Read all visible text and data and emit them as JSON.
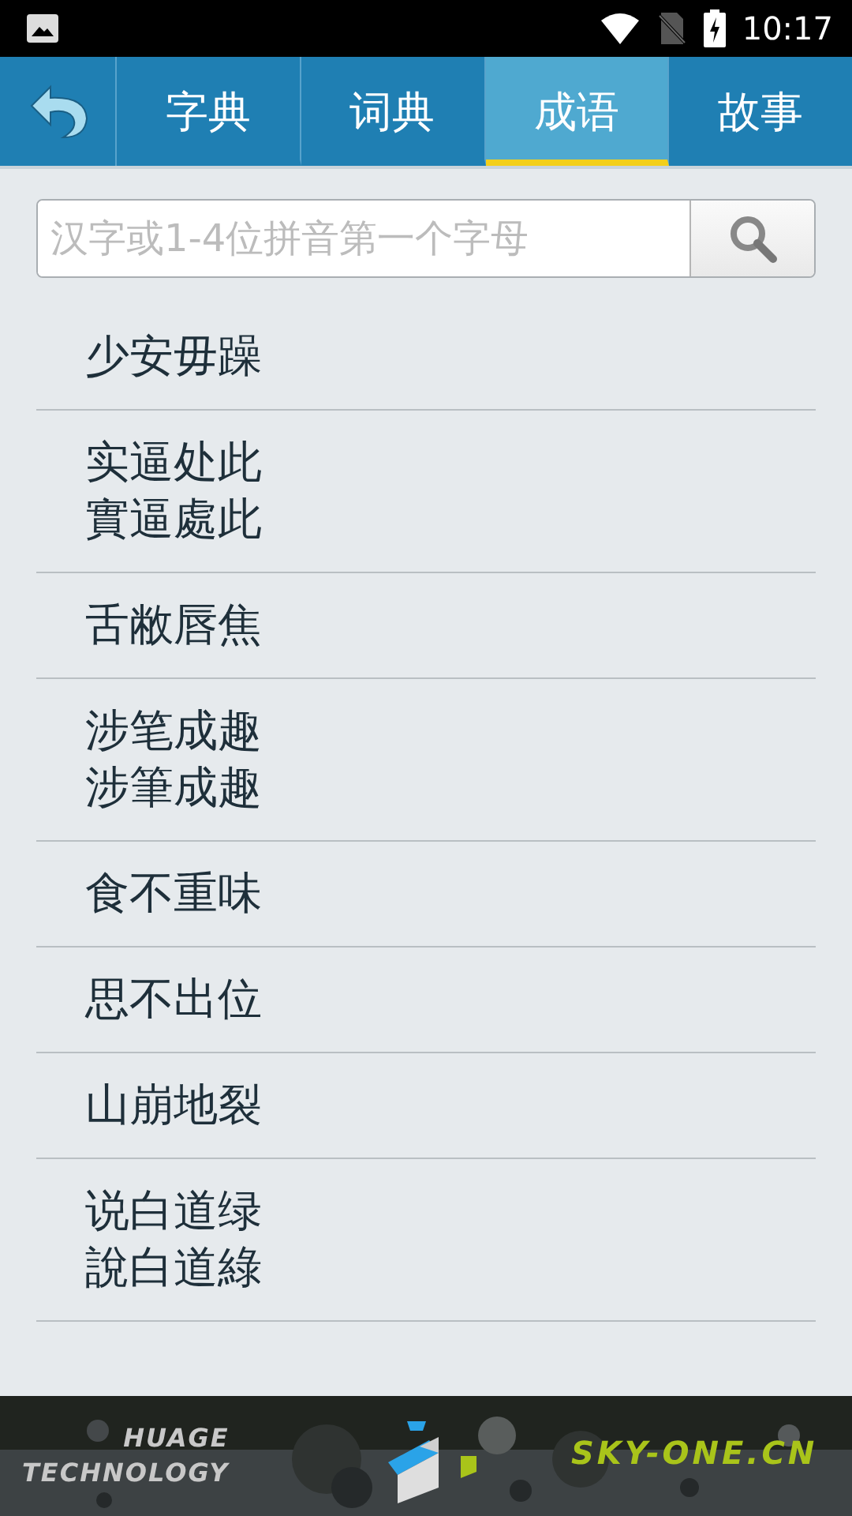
{
  "status_bar": {
    "time": "10:17"
  },
  "tabs": [
    {
      "label": "字典",
      "selected": false
    },
    {
      "label": "词典",
      "selected": false
    },
    {
      "label": "成语",
      "selected": true
    },
    {
      "label": "故事",
      "selected": false
    }
  ],
  "search": {
    "placeholder": "汉字或1-4位拼音第一个字母"
  },
  "items": [
    {
      "lines": [
        "少安毋躁"
      ]
    },
    {
      "lines": [
        "实逼处此",
        "實逼處此"
      ]
    },
    {
      "lines": [
        "舌敝唇焦"
      ]
    },
    {
      "lines": [
        "涉笔成趣",
        "涉筆成趣"
      ]
    },
    {
      "lines": [
        "食不重味"
      ]
    },
    {
      "lines": [
        "思不出位"
      ]
    },
    {
      "lines": [
        "山崩地裂"
      ]
    },
    {
      "lines": [
        "说白道绿",
        "說白道綠"
      ]
    }
  ],
  "banner": {
    "brand": "HUAGE",
    "brand_sub": "TECHNOLOGY",
    "site": "SKY-ONE.CN"
  }
}
